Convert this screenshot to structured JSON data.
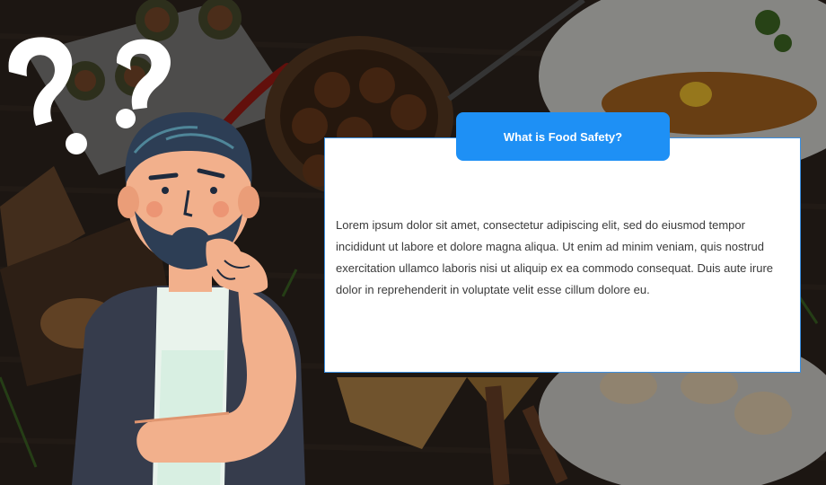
{
  "colors": {
    "accent": "#1e90f5",
    "card_background": "#ffffff",
    "card_border": "#3b8fe0",
    "text": "#3a3a3a",
    "background": "#2a211c"
  },
  "card": {
    "title": "What is Food Safety?",
    "body": "Lorem ipsum dolor sit amet, consectetur adipiscing elit, sed do eiusmod tempor incididunt ut labore et dolore magna aliqua. Ut enim ad minim veniam, quis nostrud exercitation ullamco laboris nisi ut aliquip ex ea commodo consequat. Duis aute irure dolor in reprehenderit in voluptate velit esse cillum dolore eu."
  },
  "illustration": {
    "icon": "thinking-man-icon",
    "question_marks": "question-mark-icon"
  }
}
